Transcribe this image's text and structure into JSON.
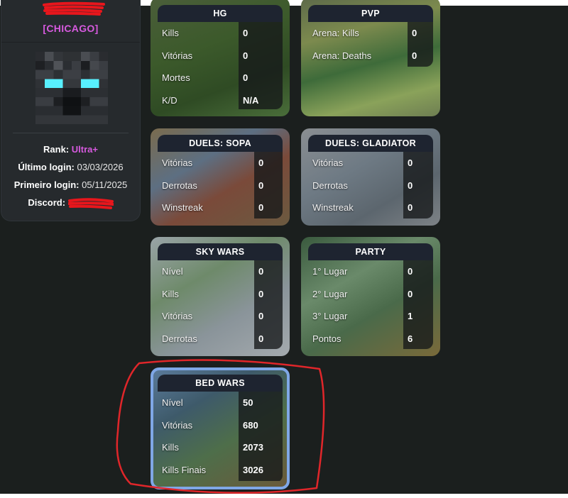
{
  "profile": {
    "clan_tag": "[CHICAGO]",
    "rank_label": "Rank:",
    "rank_value": "Ultra+",
    "last_login_label": "Último login:",
    "last_login_value": "03/03/2026",
    "first_login_label": "Primeiro login:",
    "first_login_value": "05/11/2025",
    "discord_label": "Discord:"
  },
  "cards": {
    "hg": {
      "title": "HG",
      "rows": [
        {
          "label": "Kills",
          "value": "0"
        },
        {
          "label": "Vitórias",
          "value": "0"
        },
        {
          "label": "Mortes",
          "value": "0"
        },
        {
          "label": "K/D",
          "value": "N/A"
        }
      ]
    },
    "pvp": {
      "title": "PVP",
      "rows": [
        {
          "label": "Arena: Kills",
          "value": "0"
        },
        {
          "label": "Arena: Deaths",
          "value": "0"
        }
      ]
    },
    "duels_sopa": {
      "title": "DUELS: SOPA",
      "rows": [
        {
          "label": "Vitórias",
          "value": "0"
        },
        {
          "label": "Derrotas",
          "value": "0"
        },
        {
          "label": "Winstreak",
          "value": "0"
        }
      ]
    },
    "duels_gladiator": {
      "title": "DUELS: GLADIATOR",
      "rows": [
        {
          "label": "Vitórias",
          "value": "0"
        },
        {
          "label": "Derrotas",
          "value": "0"
        },
        {
          "label": "Winstreak",
          "value": "0"
        }
      ]
    },
    "sky_wars": {
      "title": "SKY WARS",
      "rows": [
        {
          "label": "Nível",
          "value": "0"
        },
        {
          "label": "Kills",
          "value": "0"
        },
        {
          "label": "Vitórias",
          "value": "0"
        },
        {
          "label": "Derrotas",
          "value": "0"
        }
      ]
    },
    "party": {
      "title": "PARTY",
      "rows": [
        {
          "label": "1° Lugar",
          "value": "0"
        },
        {
          "label": "2° Lugar",
          "value": "0"
        },
        {
          "label": "3° Lugar",
          "value": "1"
        },
        {
          "label": "Pontos",
          "value": "6"
        }
      ]
    },
    "bed_wars": {
      "title": "BED WARS",
      "rows": [
        {
          "label": "Nível",
          "value": "50"
        },
        {
          "label": "Vitórias",
          "value": "680"
        },
        {
          "label": "Kills",
          "value": "2073"
        },
        {
          "label": "Kills Finais",
          "value": "3026"
        }
      ]
    }
  },
  "colors": {
    "page_background": "#1b1f1e",
    "accent_purple": "#d75adf",
    "bed_wars_border": "#7fa7e6",
    "annotation_red": "#e0262a",
    "redaction_red": "#e8161c"
  }
}
